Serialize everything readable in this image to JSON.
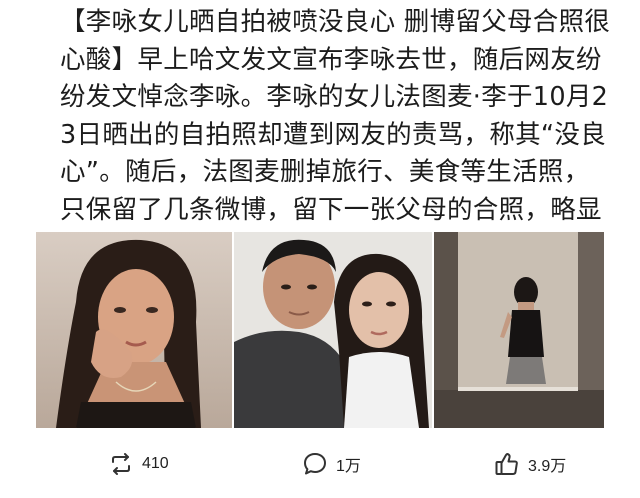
{
  "post": {
    "text": "【李咏女儿晒自拍被喷没良心 删博留父母合照很心酸】早上哈文发文宣布李咏去世，随后网友纷纷发文悼念李咏。李咏的女儿法图麦·李于10月23日晒出的自拍照却遭到网友的责骂，称其“没良心”。随后，法图麦删掉旅行、美食等生活照，只保留了几条微博，留下一张父母的合照，略显心酸。"
  },
  "actions": {
    "repost_count": "410",
    "comment_count": "1万",
    "like_count": "3.9万"
  },
  "icons": {
    "repost": "repost-icon",
    "comment": "comment-icon",
    "like": "thumbs-up-icon"
  }
}
